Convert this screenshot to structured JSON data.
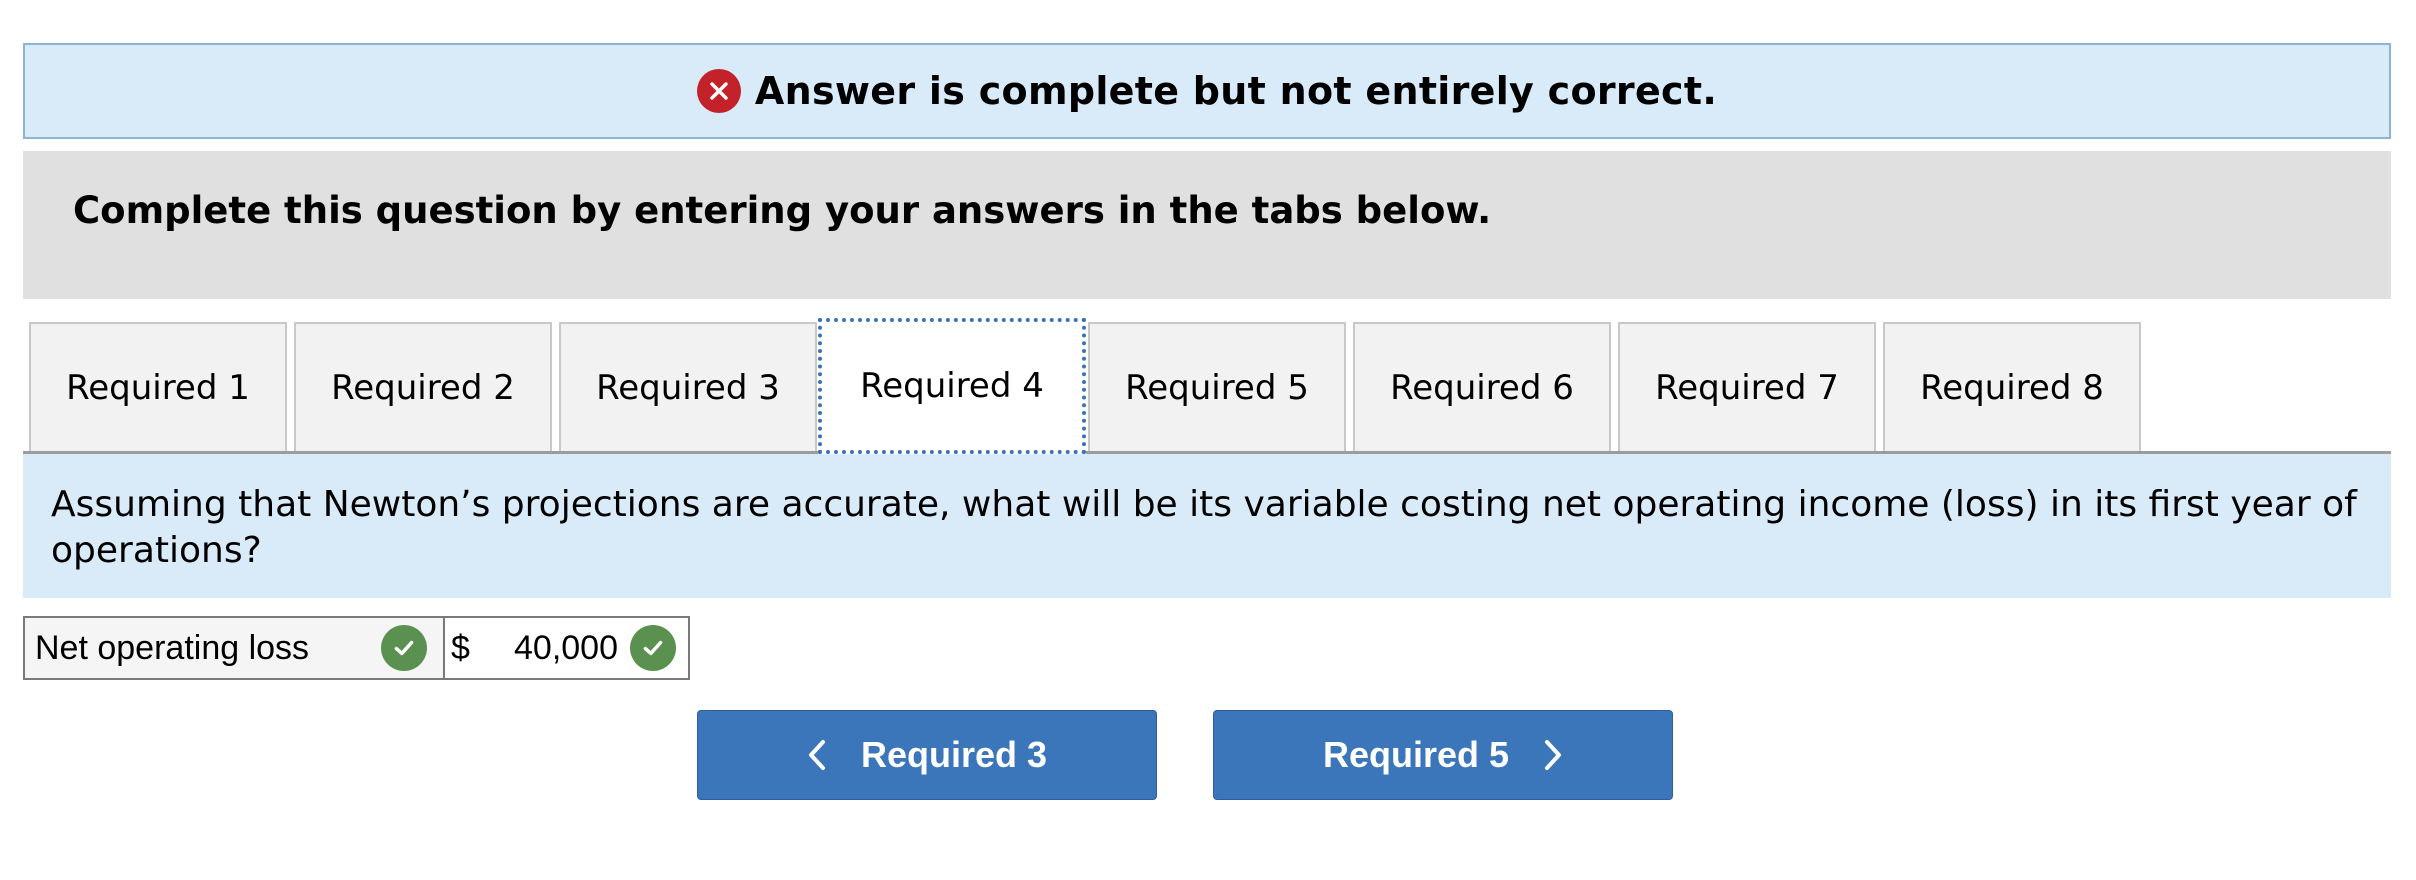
{
  "banner": {
    "text": "Answer is complete but not entirely correct.",
    "icon": "x-circle-icon",
    "color": "#c4222b"
  },
  "instruction": "Complete this question by entering your answers in the tabs below.",
  "tabs": [
    {
      "label": "Required 1",
      "active": false
    },
    {
      "label": "Required 2",
      "active": false
    },
    {
      "label": "Required 3",
      "active": false
    },
    {
      "label": "Required 4",
      "active": true
    },
    {
      "label": "Required 5",
      "active": false
    },
    {
      "label": "Required 6",
      "active": false
    },
    {
      "label": "Required 7",
      "active": false
    },
    {
      "label": "Required 8",
      "active": false
    }
  ],
  "question": "Assuming that Newton’s projections are accurate, what will be its variable costing net operating income (loss) in its first year of operations?",
  "answer": {
    "label": "Net operating loss",
    "currency": "$",
    "value": "40,000",
    "label_status_icon": "check-circle-icon",
    "value_status_icon": "check-circle-icon",
    "status_color": "#5b9150"
  },
  "nav": {
    "prev_label": "Required 3",
    "next_label": "Required 5",
    "color": "#3b76bb"
  }
}
